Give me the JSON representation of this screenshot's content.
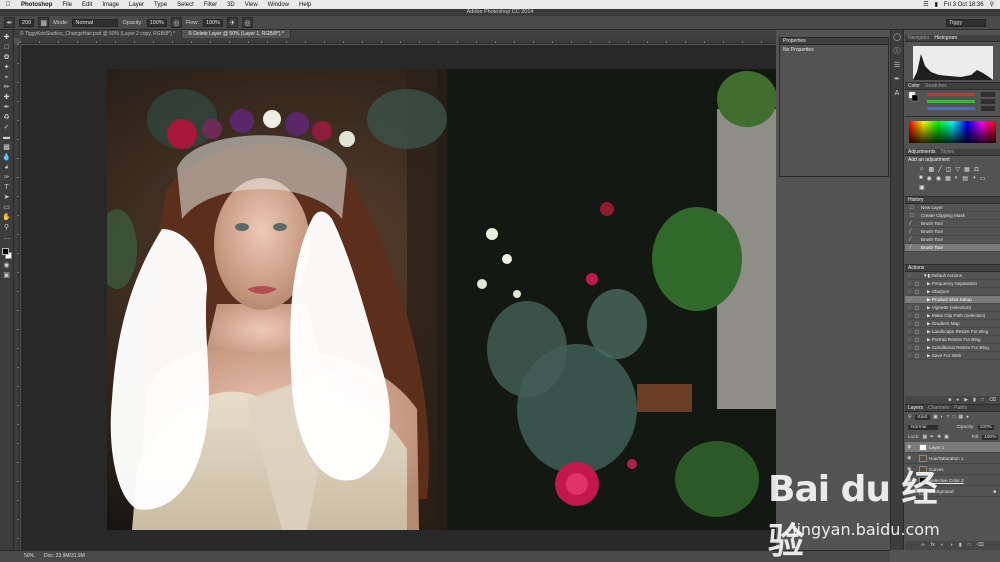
{
  "menubar": {
    "app": "Photoshop",
    "items": [
      "File",
      "Edit",
      "Image",
      "Layer",
      "Type",
      "Select",
      "Filter",
      "3D",
      "View",
      "Window",
      "Help"
    ],
    "clock": "Fri 3 Oct 18:36"
  },
  "window": {
    "title": "Adobe Photoshop CC 2014"
  },
  "options_bar": {
    "brush_size": "200",
    "mode_label": "Mode:",
    "mode_value": "Normal",
    "opacity_label": "Opacity:",
    "opacity_value": "100%",
    "flow_label": "Flow:",
    "flow_value": "100%",
    "workspace": "Tiggy"
  },
  "tabs": [
    {
      "label": "© TiggyKrieStudios_ChangeHair.psd @ 50% (Layer 2 copy, RGB/8*) *",
      "active": false
    },
    {
      "label": "© Delete Layer @ 50% (Layer 1, RGB/8*) *",
      "active": true
    }
  ],
  "properties": {
    "title": "Properties",
    "content": "No Properties"
  },
  "navigator": {
    "tabs": [
      "Navigator",
      "Histogram"
    ]
  },
  "color_panel": {
    "tabs": [
      "Color",
      "Swatches"
    ],
    "colors": {
      "r": "#e23b3b",
      "g": "#3bbf3b",
      "b": "#3b6fe2"
    }
  },
  "adjustments": {
    "tabs": [
      "Adjustments",
      "Styles"
    ],
    "heading": "Add an adjustment"
  },
  "history": {
    "title": "History",
    "items": [
      "New Layer",
      "Create Clipping Mask",
      "Brush Tool",
      "Brush Tool",
      "Brush Tool",
      "Brush Tool"
    ],
    "selected_index": 5
  },
  "actions": {
    "title": "Actions",
    "items": [
      "Default Actions",
      "Frequency Separation",
      "Sharpen",
      "Product Shot Setup",
      "Vignette (selection)",
      "Make Clip Path (selection)",
      "Gradient Map",
      "Landscape Resize For Blog",
      "Portrait Resize For Blog",
      "Conditional Resize For Blog",
      "Save For Web"
    ],
    "selected_index": 3
  },
  "layers": {
    "tabs": [
      "Layers",
      "Channels",
      "Paths"
    ],
    "kind": "Kind",
    "blend": "Normal",
    "opacity_label": "Opacity:",
    "opacity": "100%",
    "lock_label": "Lock:",
    "fill_label": "Fill:",
    "fill": "100%",
    "items": [
      "Layer 1",
      "Hue/Saturation 1",
      "Curves",
      "Selective Color 2",
      "Background"
    ]
  },
  "status": {
    "zoom": "50%",
    "doc": "Doc: 23.9M/31.9M"
  },
  "watermark": {
    "logo": "Bai du 经验",
    "url": "jingyan.baidu.com"
  }
}
